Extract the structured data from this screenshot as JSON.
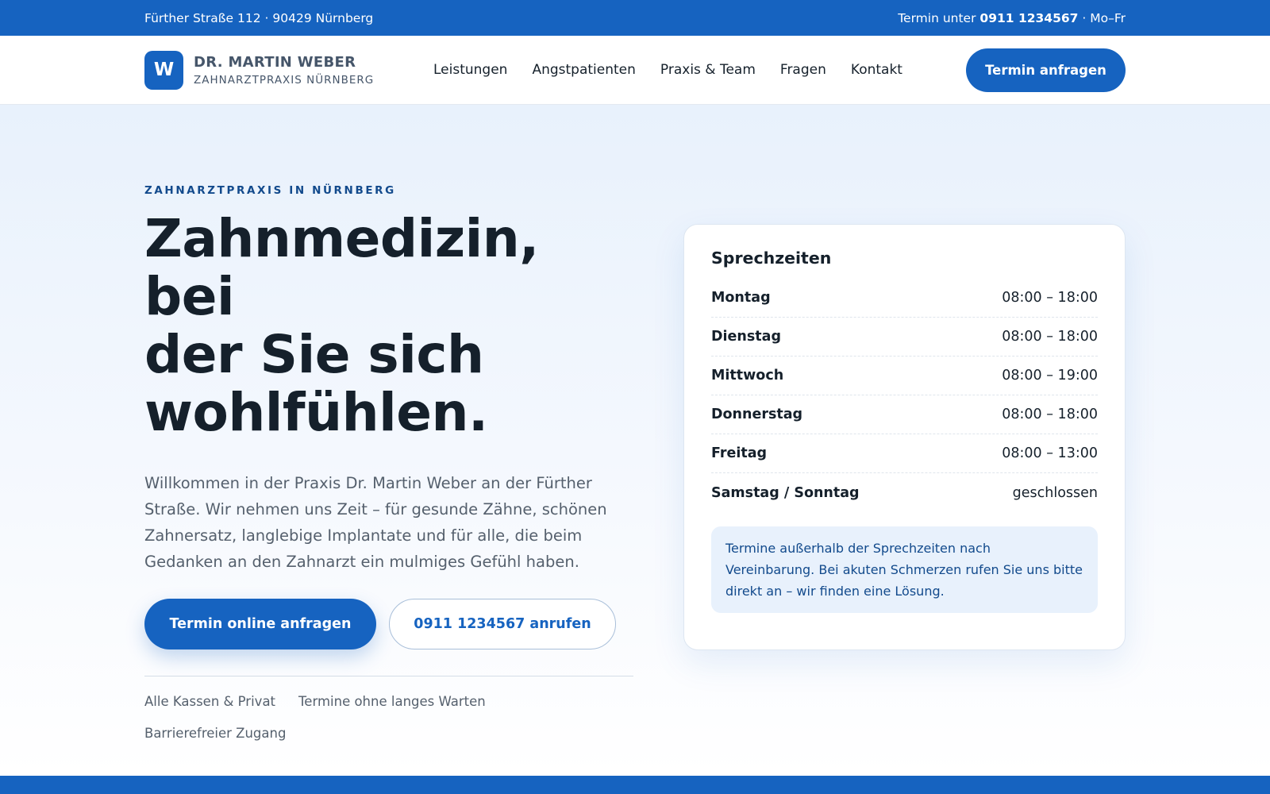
{
  "topbar": {
    "address": "Fürther Straße 112 · 90429 Nürnberg",
    "phone_prefix": "Termin unter",
    "phone": "0911 1234567",
    "phone_suffix": "· Mo–Fr"
  },
  "brand": {
    "mark": "W",
    "name": "DR. MARTIN WEBER",
    "subtitle": "ZAHNARZTPRAXIS NÜRNBERG"
  },
  "nav": {
    "items": [
      "Leistungen",
      "Angstpatienten",
      "Praxis & Team",
      "Fragen",
      "Kontakt"
    ],
    "cta": "Termin anfragen"
  },
  "hero": {
    "eyebrow": "ZAHNARZTPRAXIS IN NÜRNBERG",
    "headline_lines": [
      "Zahnmedizin, bei",
      "der Sie sich",
      "wohlfühlen."
    ],
    "lead": "Willkommen in der Praxis Dr. Martin Weber an der Fürther Straße. Wir nehmen uns Zeit – für gesunde Zähne, schönen Zahnersatz, langlebige Implantate und für alle, die beim Gedanken an den Zahnarzt ein mulmiges Gefühl haben.",
    "primary_cta": "Termin online anfragen",
    "secondary_cta": "0911 1234567 anrufen",
    "features": [
      "Alle Kassen & Privat",
      "Termine ohne langes Warten",
      "Barrierefreier Zugang"
    ]
  },
  "hours_card": {
    "title": "Sprechzeiten",
    "rows": [
      {
        "day": "Montag",
        "time": "08:00 – 18:00"
      },
      {
        "day": "Dienstag",
        "time": "08:00 – 18:00"
      },
      {
        "day": "Mittwoch",
        "time": "08:00 – 19:00"
      },
      {
        "day": "Donnerstag",
        "time": "08:00 – 18:00"
      },
      {
        "day": "Freitag",
        "time": "08:00 – 13:00"
      },
      {
        "day": "Samstag / Sonntag",
        "time": "geschlossen"
      }
    ],
    "note": "Termine außerhalb der Sprechzeiten nach Vereinbarung. Bei akuten Schmerzen rufen Sie uns bitte direkt an – wir finden eine Lösung."
  },
  "colors": {
    "primary": "#1663c0",
    "primary_dark": "#124a8c",
    "text": "#15202b",
    "muted": "#55606d",
    "hero_bg": "#e8f1fc"
  }
}
